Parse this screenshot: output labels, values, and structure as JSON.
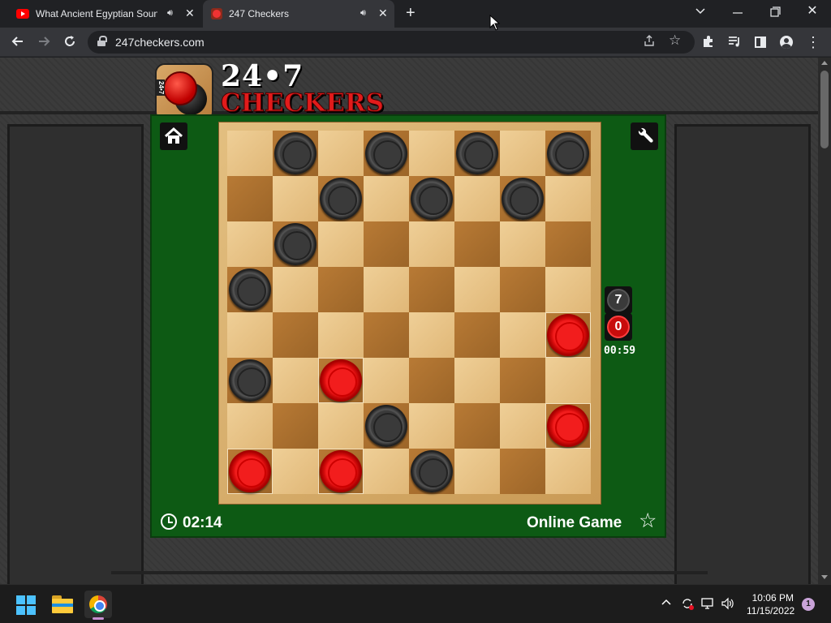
{
  "tabs": [
    {
      "title": "What Ancient Egyptian Soun",
      "icon": "youtube-icon",
      "audio": "speaker-icon",
      "close": "✕"
    },
    {
      "title": "247 Checkers",
      "icon": "checkers-favicon",
      "audio": "speaker-icon",
      "close": "✕",
      "active": true
    }
  ],
  "toolbar": {
    "url": "247checkers.com"
  },
  "site": {
    "logo_number": "24•7",
    "logo_word": "CHECKERS",
    "logo_badge": "24•7"
  },
  "game": {
    "board": {
      "rows": 8,
      "cols": 8,
      "pieces": [
        {
          "row": 0,
          "col": 1,
          "color": "black"
        },
        {
          "row": 0,
          "col": 3,
          "color": "black"
        },
        {
          "row": 0,
          "col": 5,
          "color": "black"
        },
        {
          "row": 0,
          "col": 7,
          "color": "black"
        },
        {
          "row": 1,
          "col": 2,
          "color": "black"
        },
        {
          "row": 1,
          "col": 4,
          "color": "black"
        },
        {
          "row": 1,
          "col": 6,
          "color": "black"
        },
        {
          "row": 2,
          "col": 1,
          "color": "black"
        },
        {
          "row": 3,
          "col": 0,
          "color": "black"
        },
        {
          "row": 4,
          "col": 7,
          "color": "red"
        },
        {
          "row": 5,
          "col": 0,
          "color": "black"
        },
        {
          "row": 5,
          "col": 2,
          "color": "red"
        },
        {
          "row": 6,
          "col": 3,
          "color": "black"
        },
        {
          "row": 6,
          "col": 7,
          "color": "red"
        },
        {
          "row": 7,
          "col": 0,
          "color": "red"
        },
        {
          "row": 7,
          "col": 2,
          "color": "red"
        },
        {
          "row": 7,
          "col": 4,
          "color": "black"
        }
      ]
    },
    "score_black": "7",
    "score_red": "0",
    "turn_timer": "00:59",
    "game_timer": "02:14",
    "mode": "Online Game"
  },
  "taskbar": {
    "time": "10:06 PM",
    "date": "11/15/2022",
    "notifications": "1"
  },
  "colors": {
    "felt": "#0d5a14",
    "light_square": "#efcf97",
    "dark_square": "#b87a35",
    "red_piece": "#e01010",
    "black_piece": "#333333"
  }
}
